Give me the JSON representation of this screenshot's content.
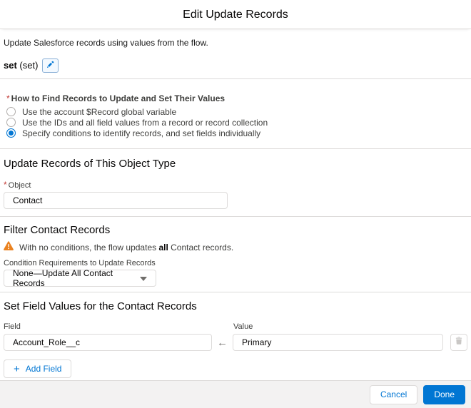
{
  "header": {
    "title": "Edit Update Records"
  },
  "intro": {
    "description": "Update Salesforce records using values from the flow.",
    "api_name_bold": "set",
    "api_name_suffix": " (set)"
  },
  "find_records": {
    "required_mark": "*",
    "label": "How to Find Records to Update and Set Their Values",
    "options": [
      {
        "label": "Use the account $Record global variable",
        "selected": false
      },
      {
        "label": "Use the IDs and all field values from a record or record collection",
        "selected": false
      },
      {
        "label": "Specify conditions to identify records, and set fields individually",
        "selected": true
      }
    ]
  },
  "object_section": {
    "heading": "Update Records of This Object Type",
    "required_mark": "*",
    "field_label": "Object",
    "value": "Contact"
  },
  "filter_section": {
    "heading": "Filter Contact Records",
    "warning_pre": "With no conditions, the flow updates ",
    "warning_bold": "all",
    "warning_post": " Contact records.",
    "condition_label": "Condition Requirements to Update Records",
    "condition_value": "None—Update All Contact Records"
  },
  "set_values_section": {
    "heading": "Set Field Values for the Contact Records",
    "field_label": "Field",
    "value_label": "Value",
    "field_value": "Account_Role__c",
    "value_value": "Primary",
    "arrow_glyph": "←",
    "plus_glyph": "+",
    "add_field_label": "Add Field"
  },
  "footer": {
    "cancel_label": "Cancel",
    "done_label": "Done"
  },
  "colors": {
    "accent_blue": "#0176d3",
    "warning_orange": "#ea8220",
    "border_gray": "#dddbda",
    "footer_bg": "#f3f2f2",
    "required_red": "#c23934",
    "text_dark": "#080707",
    "label_gray": "#3e3e3c"
  }
}
